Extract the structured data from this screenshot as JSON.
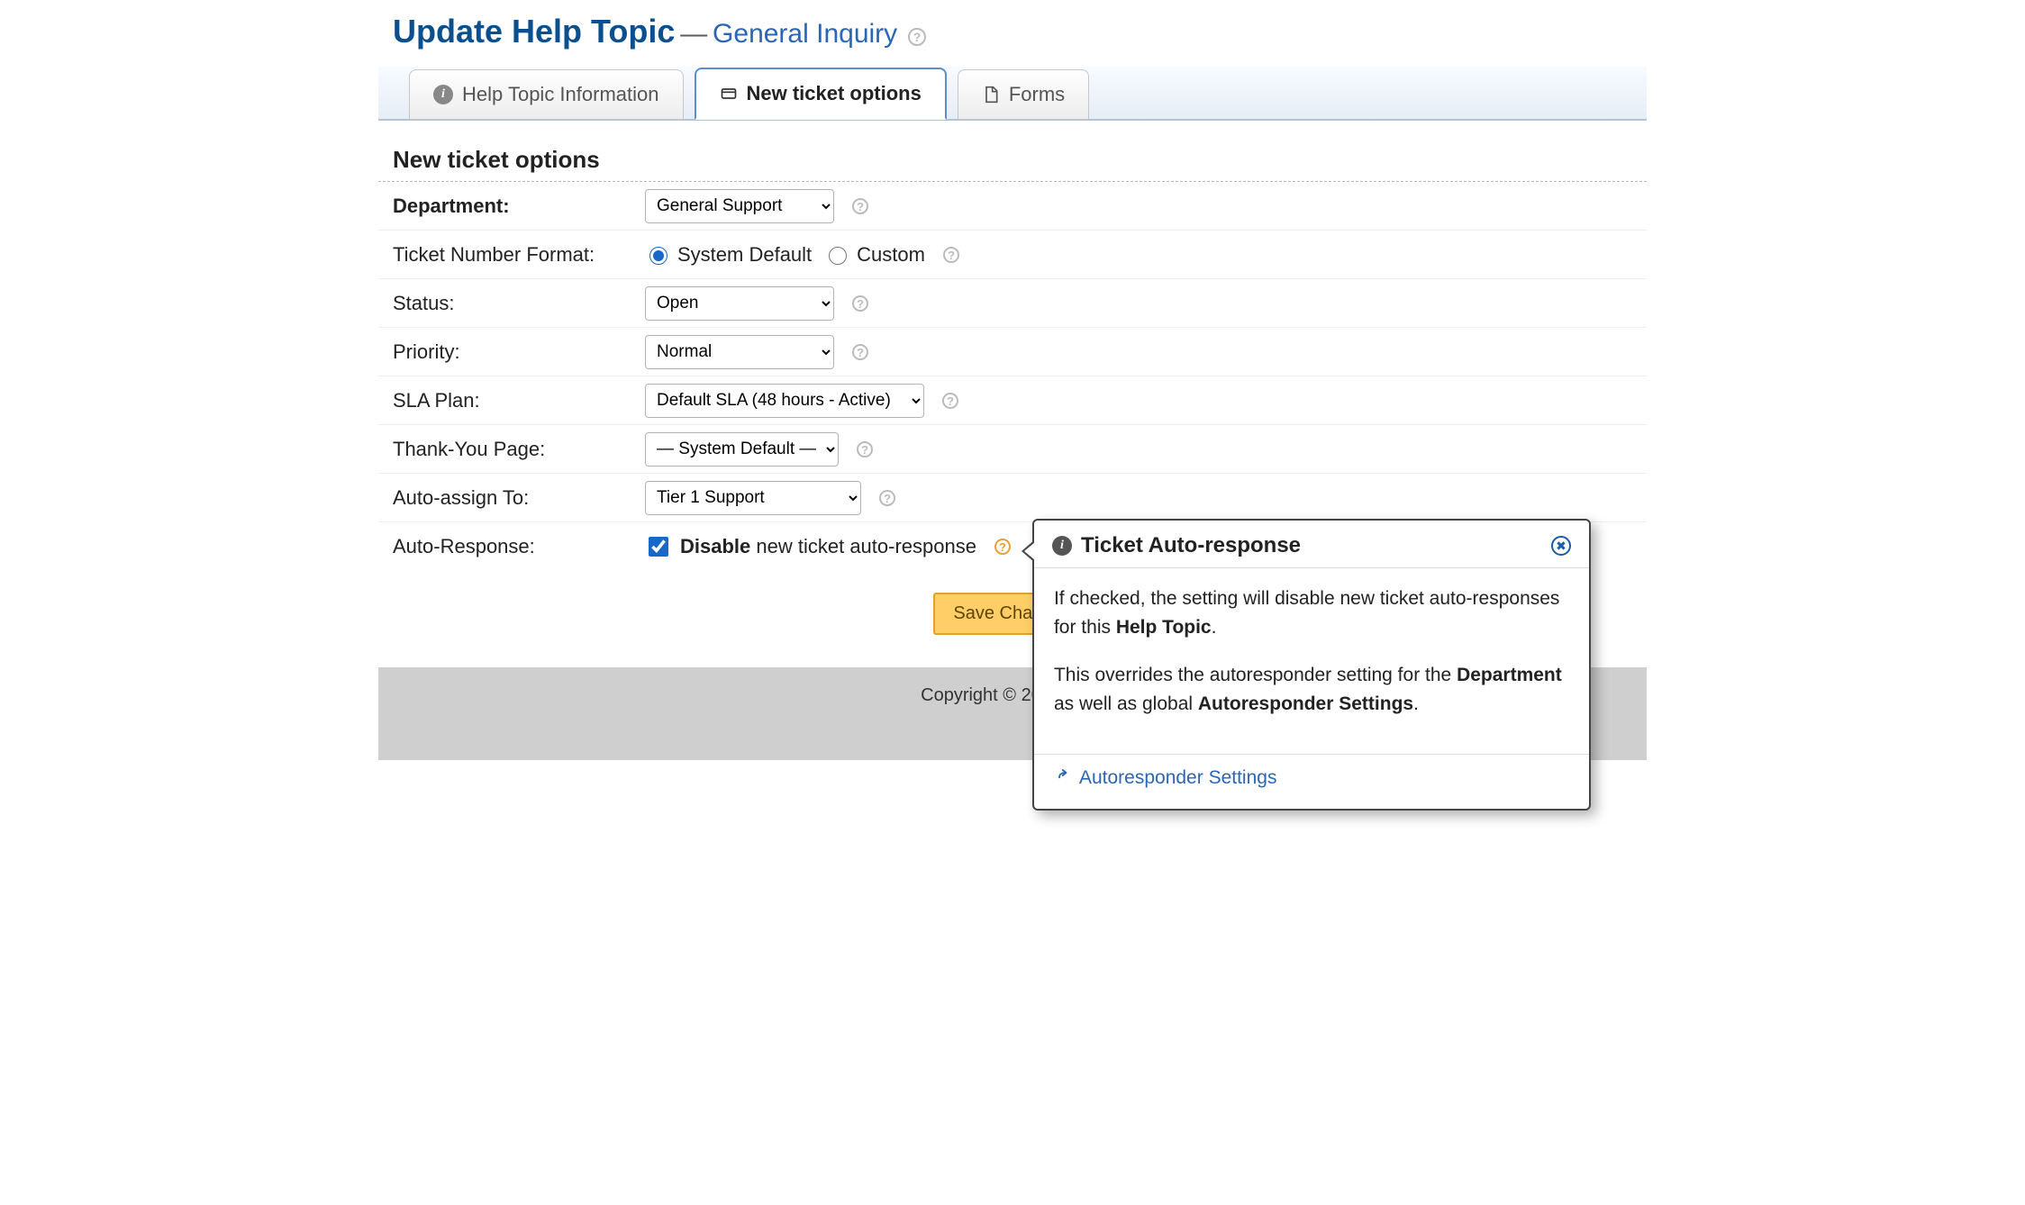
{
  "header": {
    "title": "Update Help Topic",
    "separator": "—",
    "subtitle": "General Inquiry"
  },
  "tabs": [
    {
      "label": "Help Topic Information"
    },
    {
      "label": "New ticket options"
    },
    {
      "label": "Forms"
    }
  ],
  "section_heading": "New ticket options",
  "form": {
    "department": {
      "label": "Department:",
      "value": "General Support"
    },
    "ticket_number_format": {
      "label": "Ticket Number Format:",
      "option1": "System Default",
      "option2": "Custom",
      "selected": "system_default"
    },
    "status": {
      "label": "Status:",
      "value": "Open"
    },
    "priority": {
      "label": "Priority:",
      "value": "Normal"
    },
    "sla_plan": {
      "label": "SLA Plan:",
      "value": "Default SLA (48 hours - Active)"
    },
    "thank_you_page": {
      "label": "Thank-You Page:",
      "value": "— System Default —"
    },
    "auto_assign_to": {
      "label": "Auto-assign To:",
      "value": "Tier 1 Support"
    },
    "auto_response": {
      "label": "Auto-Response:",
      "checkbox_bold": "Disable",
      "checkbox_rest": "new ticket auto-response",
      "checked": true
    }
  },
  "buttons": {
    "save": "Save Changes"
  },
  "footer": {
    "copyright": "Copyright © 2021 Para"
  },
  "popover": {
    "title": "Ticket Auto-response",
    "p1a": "If checked, the setting will disable new ticket auto-responses for this ",
    "p1b": "Help Topic",
    "p1c": ".",
    "p2a": "This overrides the autoresponder setting for the ",
    "p2b": "Department",
    "p2c": " as well as global ",
    "p2d": "Autoresponder Settings",
    "p2e": ".",
    "link": "Autoresponder Settings"
  }
}
